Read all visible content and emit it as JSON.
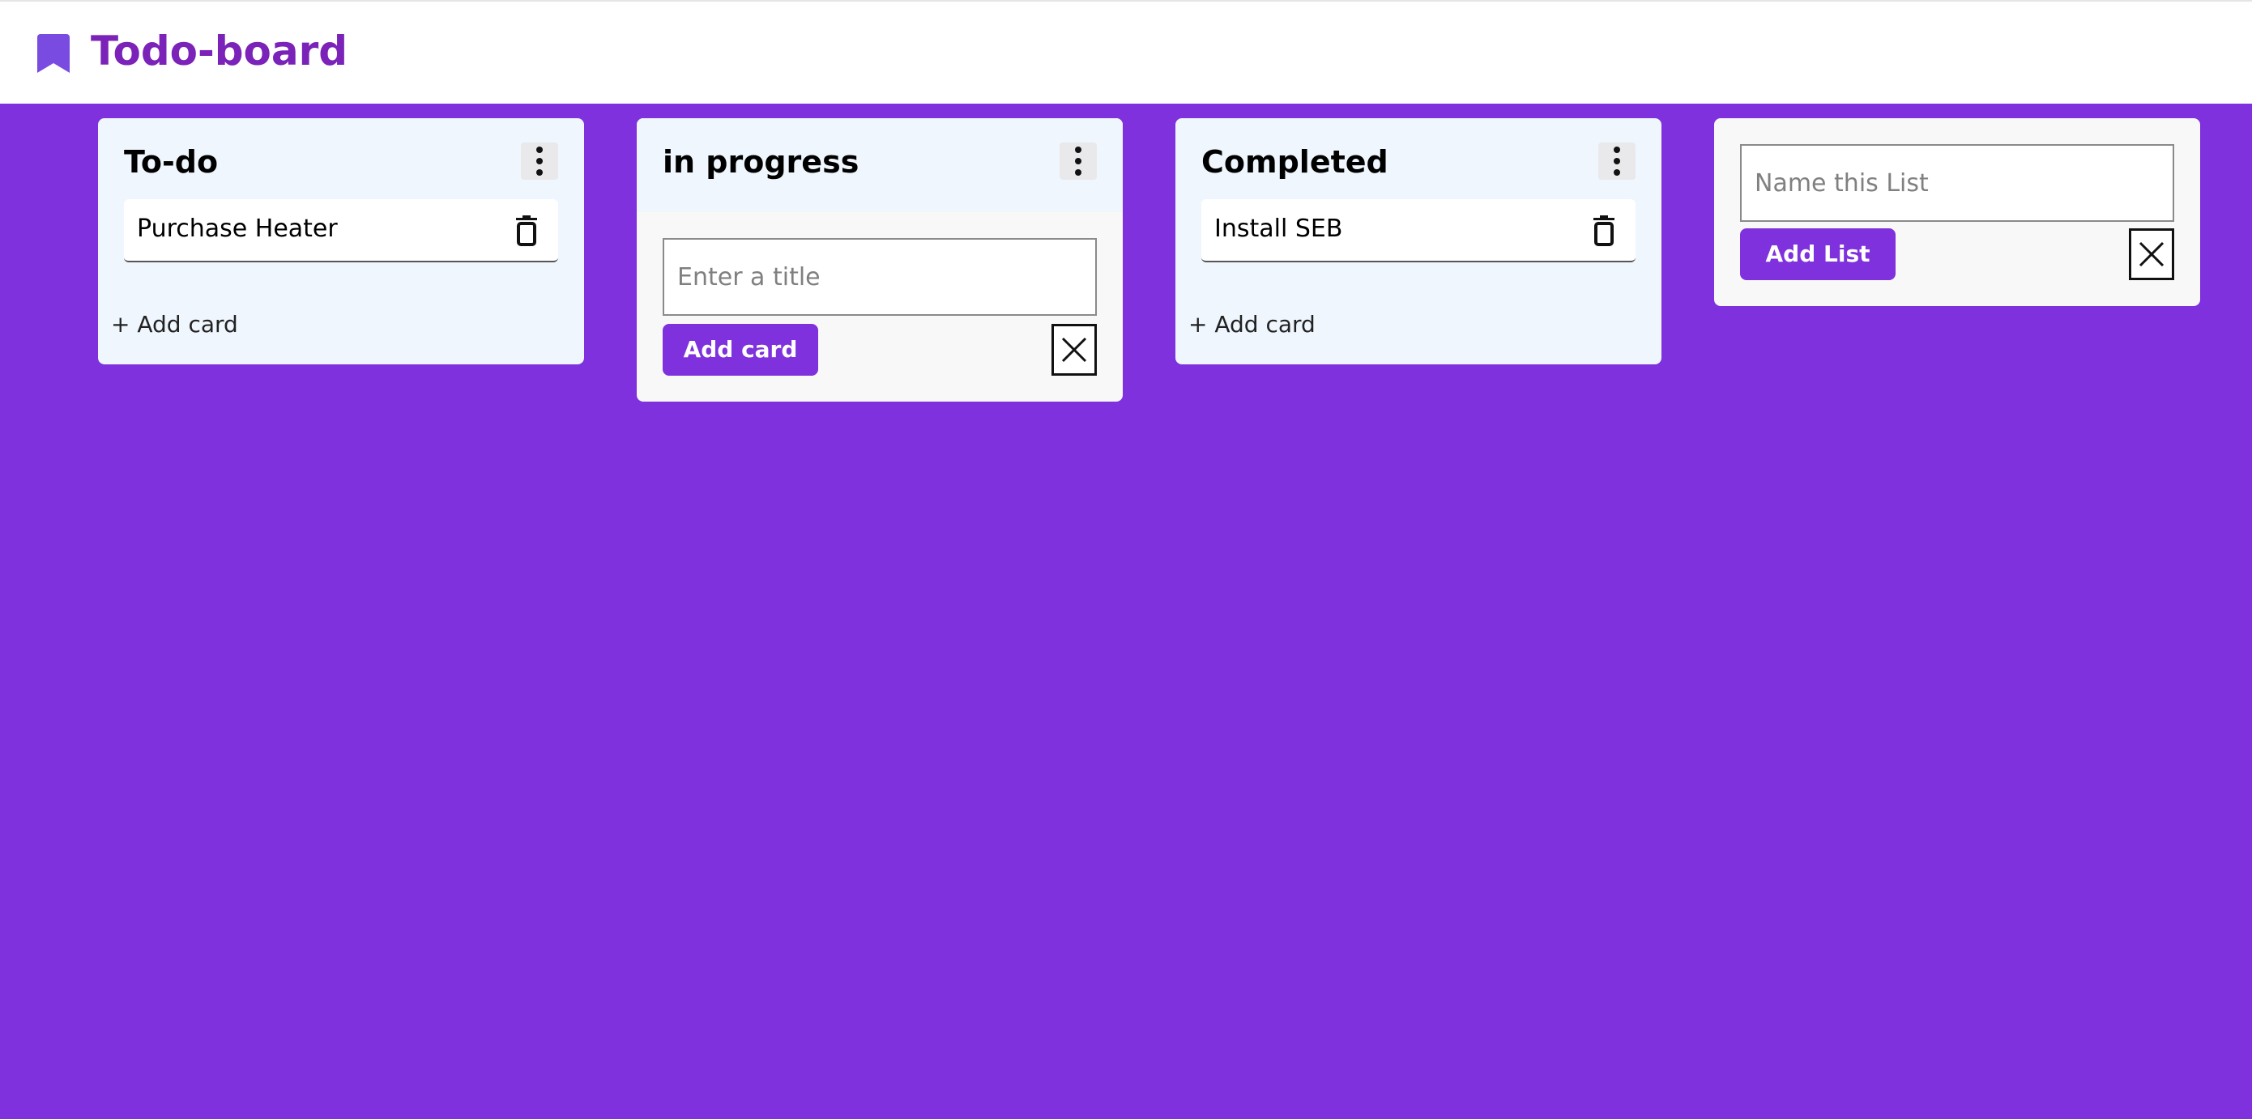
{
  "header": {
    "title": "Todo-board",
    "logo_icon": "bookmark-icon",
    "brand_color": "#7b22b8"
  },
  "theme": {
    "background": "#7e31dc",
    "accent": "#7e31dc"
  },
  "lists": [
    {
      "title": "To-do",
      "cards": [
        {
          "text": "Purchase Heater"
        }
      ],
      "add_card_label": "+ Add card"
    },
    {
      "title": "in progress",
      "new_card_input": {
        "placeholder": "Enter a title",
        "value": ""
      },
      "add_card_button": "Add card"
    },
    {
      "title": "Completed",
      "cards": [
        {
          "text": "Install SEB"
        }
      ],
      "add_card_label": "+ Add card"
    }
  ],
  "new_list": {
    "input_placeholder": "Name this List",
    "input_value": "",
    "add_button": "Add List"
  },
  "icons": {
    "list_menu": "vertical-dots-icon",
    "card_delete": "trash-icon",
    "close": "close-icon"
  }
}
